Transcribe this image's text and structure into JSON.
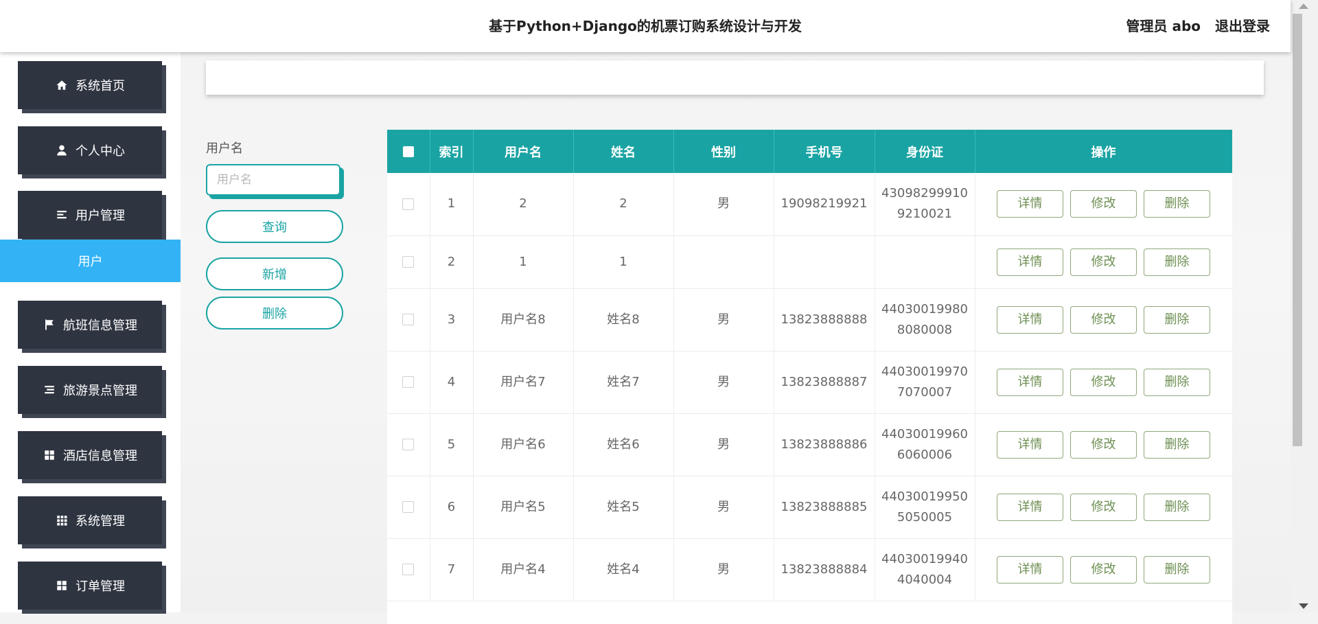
{
  "header": {
    "title": "基于Python+Django的机票订购系统设计与开发",
    "user_label": "管理员 abo",
    "logout_label": "退出登录"
  },
  "sidebar": {
    "items": [
      {
        "label": "系统首页",
        "icon": "home-icon"
      },
      {
        "label": "个人中心",
        "icon": "user-icon"
      },
      {
        "label": "用户管理",
        "icon": "list-icon"
      },
      {
        "label": "航班信息管理",
        "icon": "flag-icon"
      },
      {
        "label": "旅游景点管理",
        "icon": "list-icon"
      },
      {
        "label": "酒店信息管理",
        "icon": "grid-icon"
      },
      {
        "label": "系统管理",
        "icon": "apps-icon"
      },
      {
        "label": "订单管理",
        "icon": "grid-icon"
      }
    ],
    "active_sub_label": "用户"
  },
  "search": {
    "field_label": "用户名",
    "placeholder": "用户名",
    "query_button": "查询",
    "add_button": "新增",
    "delete_button": "删除"
  },
  "table": {
    "columns": [
      "索引",
      "用户名",
      "姓名",
      "性别",
      "手机号",
      "身份证",
      "操作"
    ],
    "actions": {
      "detail": "详情",
      "edit": "修改",
      "delete": "删除"
    },
    "rows": [
      {
        "index": "1",
        "username": "2",
        "name": "2",
        "gender": "男",
        "phone": "19098219921",
        "id_card": [
          "43098299910",
          "9210021"
        ]
      },
      {
        "index": "2",
        "username": "1",
        "name": "1",
        "gender": "",
        "phone": "",
        "id_card": [
          "",
          ""
        ]
      },
      {
        "index": "3",
        "username": "用户名8",
        "name": "姓名8",
        "gender": "男",
        "phone": "13823888888",
        "id_card": [
          "44030019980",
          "8080008"
        ]
      },
      {
        "index": "4",
        "username": "用户名7",
        "name": "姓名7",
        "gender": "男",
        "phone": "13823888887",
        "id_card": [
          "44030019970",
          "7070007"
        ]
      },
      {
        "index": "5",
        "username": "用户名6",
        "name": "姓名6",
        "gender": "男",
        "phone": "13823888886",
        "id_card": [
          "44030019960",
          "6060006"
        ]
      },
      {
        "index": "6",
        "username": "用户名5",
        "name": "姓名5",
        "gender": "男",
        "phone": "13823888885",
        "id_card": [
          "44030019950",
          "5050005"
        ]
      },
      {
        "index": "7",
        "username": "用户名4",
        "name": "姓名4",
        "gender": "男",
        "phone": "13823888884",
        "id_card": [
          "44030019940",
          "4040004"
        ]
      }
    ]
  },
  "colors": {
    "accent": "#1aa3a3",
    "sidebar_button": "#2e3440",
    "active_sub": "#33b3f5",
    "action_button": "#6d8f52"
  }
}
